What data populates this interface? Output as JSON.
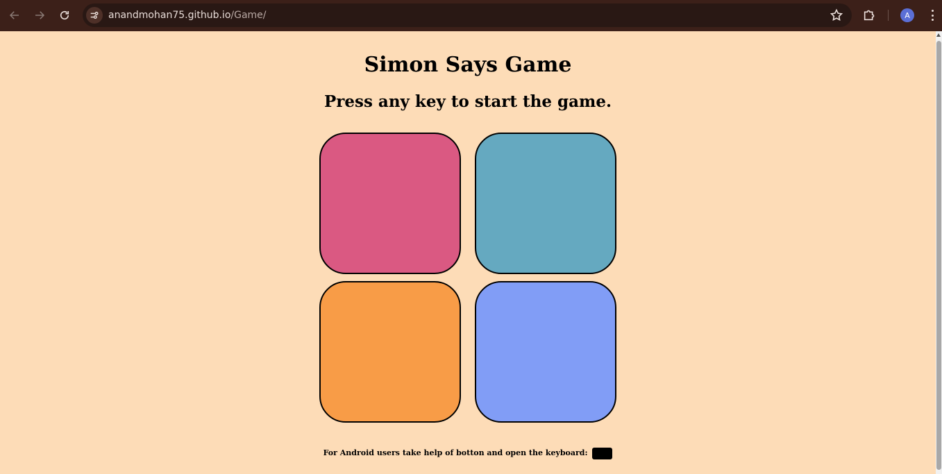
{
  "browser": {
    "url_host": "anandmohan75.github.io",
    "url_path": "/Game/",
    "profile_initial": "A",
    "icons": [
      "back-icon",
      "forward-icon",
      "reload-icon",
      "site-info-icon",
      "star-icon",
      "extensions-icon",
      "menu-icon"
    ]
  },
  "page": {
    "title": "Simon Says Game",
    "subtitle": "Press any key to start the game.",
    "buttons": [
      {
        "id": "red",
        "color": "#da5982"
      },
      {
        "id": "blue",
        "color": "#65a9c0"
      },
      {
        "id": "orange",
        "color": "#f89c47"
      },
      {
        "id": "purple",
        "color": "#819df6"
      }
    ],
    "footer_text": "For Android users take help of botton and open the keyboard:"
  }
}
